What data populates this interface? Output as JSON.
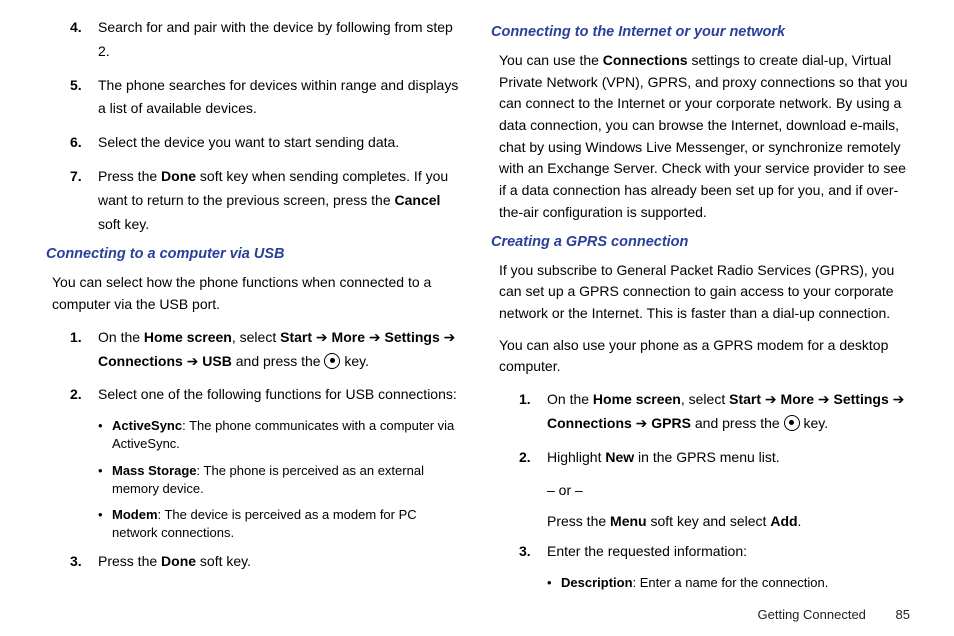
{
  "left": {
    "items_top": [
      {
        "n": "4.",
        "t": "Search for and pair with the device by following from step 2."
      },
      {
        "n": "5.",
        "t": "The phone searches for devices within range and displays a list of available devices."
      },
      {
        "n": "6.",
        "t": "Select the device you want to start sending data."
      }
    ],
    "item7": {
      "n": "7.",
      "pre": "Press the ",
      "b1": "Done",
      "mid": " soft key when sending completes. If you want to return to the previous screen, press the ",
      "b2": "Cancel",
      "post": " soft key."
    },
    "head_usb": "Connecting to a computer via USB",
    "usb_intro": "You can select how the phone functions when connected to a computer via the USB port.",
    "usb1": {
      "n": "1.",
      "pre": "On the ",
      "b1": "Home screen",
      "mid1": ", select ",
      "b2": "Start",
      "arr": " ➔ ",
      "b3": "More",
      "b4": "Settings",
      "b5": "Connections",
      "b6": "USB",
      "mid2": " and press the ",
      "post": " key."
    },
    "usb2": {
      "n": "2.",
      "t": "Select one of the following functions for USB connections:"
    },
    "bullets": [
      {
        "b": "ActiveSync",
        "t": ": The phone communicates with a computer via ActiveSync."
      },
      {
        "b": "Mass Storage",
        "t": ": The phone is perceived as an external memory device."
      },
      {
        "b": "Modem",
        "t": ": The device is perceived as a modem for PC network connections."
      }
    ],
    "usb3": {
      "n": "3.",
      "pre": "Press the ",
      "b": "Done",
      "post": " soft key."
    }
  },
  "right": {
    "head_net": "Connecting to the Internet or your network",
    "net_para_pre": "You can use the ",
    "net_para_b": "Connections",
    "net_para_post": " settings to create dial-up, Virtual Private Network (VPN), GPRS, and proxy connections so that you can connect to the Internet or your corporate network. By using a data connection, you can browse the Internet, download e-mails, chat by using Windows Live Messenger, or synchronize remotely with an Exchange Server. Check with your service provider to see if a data connection has already been set up for you, and if over-the-air configuration is supported.",
    "head_gprs": "Creating a GPRS connection",
    "gprs_p1": "If you subscribe to General Packet Radio Services (GPRS), you can set up a GPRS connection to gain access to your corporate network or the Internet. This is faster than a dial-up connection.",
    "gprs_p2": "You can also use your phone as a GPRS modem for a desktop computer.",
    "g1": {
      "n": "1.",
      "pre": "On the ",
      "b1": "Home screen",
      "mid1": ", select ",
      "b2": "Start",
      "arr": " ➔ ",
      "b3": "More",
      "b4": "Settings",
      "b5": "Connections",
      "b6": "GPRS",
      "mid2": " and press the ",
      "post": " key."
    },
    "g2": {
      "n": "2.",
      "pre": "Highlight ",
      "b": "New",
      "post": " in the GPRS menu list."
    },
    "g2_or": "– or –",
    "g2_b": {
      "pre": "Press the ",
      "b1": "Menu",
      "mid": " soft key and select ",
      "b2": "Add",
      "post": "."
    },
    "g3": {
      "n": "3.",
      "t": "Enter the requested information:"
    },
    "g3_bullet": {
      "b": "Description",
      "t": ": Enter a name for the connection."
    }
  },
  "footer": {
    "section": "Getting Connected",
    "page": "85"
  }
}
